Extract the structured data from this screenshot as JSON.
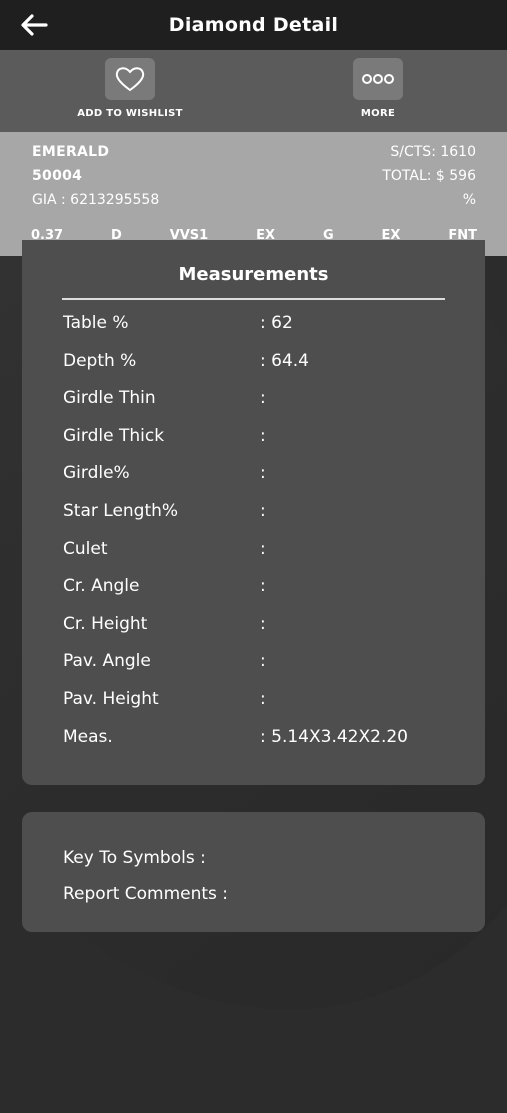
{
  "header": {
    "title": "Diamond Detail"
  },
  "actions": {
    "wishlist_label": "ADD TO WISHLIST",
    "more_label": "MORE"
  },
  "summary": {
    "shape": "EMERALD",
    "stock_id": "50004",
    "cert": "GIA : 6213295558",
    "price_per_carat": "S/CTS: 1610",
    "total": "TOTAL: $ 596",
    "discount": "%",
    "specs": [
      "0.37",
      "D",
      "VVS1",
      "EX",
      "G",
      "EX",
      "FNT"
    ]
  },
  "measurements": {
    "title": "Measurements",
    "rows": [
      {
        "label": "Table %",
        "value": ": 62"
      },
      {
        "label": "Depth %",
        "value": ": 64.4"
      },
      {
        "label": "Girdle Thin",
        "value": ":"
      },
      {
        "label": "Girdle Thick",
        "value": ":"
      },
      {
        "label": "Girdle%",
        "value": ":"
      },
      {
        "label": "Star Length%",
        "value": ":"
      },
      {
        "label": "Culet",
        "value": ":"
      },
      {
        "label": "Cr. Angle",
        "value": ":"
      },
      {
        "label": "Cr. Height",
        "value": ":"
      },
      {
        "label": "Pav. Angle",
        "value": ":"
      },
      {
        "label": "Pav. Height",
        "value": ":"
      },
      {
        "label": "Meas.",
        "value": ": 5.14X3.42X2.20"
      }
    ]
  },
  "notes": {
    "key_to_symbols": "Key To Symbols :",
    "report_comments": "Report Comments :"
  }
}
